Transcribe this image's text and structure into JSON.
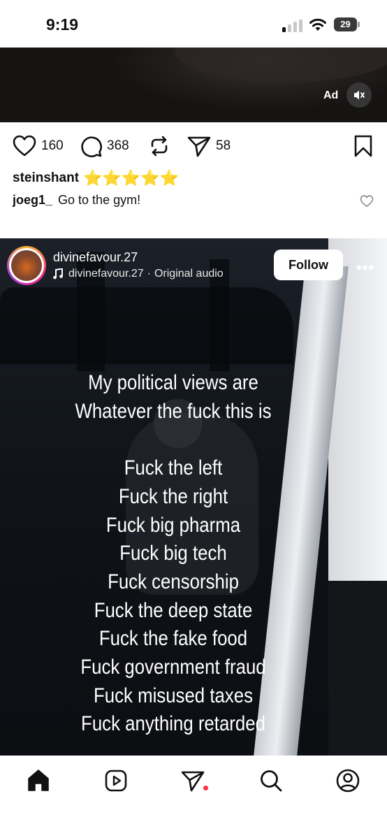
{
  "status_bar": {
    "time": "9:19",
    "battery": "29"
  },
  "ad": {
    "label": "Ad",
    "mute_icon": "speaker-muted-icon"
  },
  "post_actions": {
    "likes": "160",
    "comments": "368",
    "sends": "58",
    "icons": [
      "heart-icon",
      "comment-icon",
      "repost-icon",
      "send-icon",
      "bookmark-icon"
    ]
  },
  "caption": {
    "username": "steinshant",
    "stars": "⭐⭐⭐⭐⭐"
  },
  "comment": {
    "username": "joeg1_",
    "text": "Go to the gym!"
  },
  "reel": {
    "username": "divinefavour.27",
    "audio_user": "divinefavour.27",
    "audio_separator": "·",
    "audio_label": "Original audio",
    "follow_label": "Follow",
    "more_label": "•••",
    "overlay_lines_top": [
      "My political views are",
      "Whatever the fuck this is"
    ],
    "overlay_lines_bottom": [
      "Fuck the left",
      "Fuck the right",
      "Fuck big pharma",
      "Fuck big tech",
      "Fuck censorship",
      "Fuck the deep state",
      "Fuck the fake food",
      "Fuck government fraud",
      "Fuck misused taxes",
      "Fuck anything retarded"
    ]
  },
  "bottom_nav": {
    "items": [
      "home-icon",
      "reels-icon",
      "send-icon",
      "search-icon",
      "profile-icon"
    ],
    "notification_color": "#ff3040"
  }
}
